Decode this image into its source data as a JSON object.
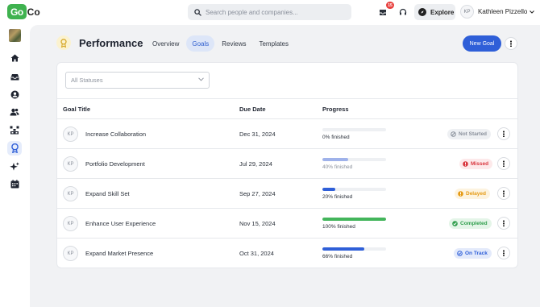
{
  "app": {
    "logo_go": "Go",
    "logo_co": "Co"
  },
  "search": {
    "placeholder": "Search people and companies..."
  },
  "header": {
    "inbox_count": "15",
    "explore_label": "Explore",
    "user_initials": "KP",
    "user_name": "Kathleen Pizzello"
  },
  "page": {
    "title": "Performance",
    "tabs": [
      {
        "label": "Overview",
        "active": false
      },
      {
        "label": "Goals",
        "active": true
      },
      {
        "label": "Reviews",
        "active": false
      },
      {
        "label": "Templates",
        "active": false
      }
    ],
    "new_goal_label": "New Goal"
  },
  "filter": {
    "selected": "All Statuses"
  },
  "table": {
    "headers": {
      "title": "Goal Title",
      "due": "Due Date",
      "progress": "Progress"
    },
    "rows": [
      {
        "initials": "KP",
        "title": "Increase Collaboration",
        "due": "Dec 31, 2024",
        "progress": 0,
        "progress_label": "0% finished",
        "status": "Not Started",
        "progress_color": "#b9c8ee",
        "status_color": "#8a909b",
        "status_bg": "#eef0f3"
      },
      {
        "initials": "KP",
        "title": "Portfolio Development",
        "due": "Jul 29, 2024",
        "progress": 40,
        "progress_label": "40% finished",
        "status": "Missed",
        "progress_color": "#9fb2ea",
        "status_color": "#d9363e",
        "status_bg": "#fde9ea"
      },
      {
        "initials": "KP",
        "title": "Expand Skill Set",
        "due": "Sep 27, 2024",
        "progress": 20,
        "progress_label": "20% finished",
        "status": "Delayed",
        "progress_color": "#2f5fd8",
        "status_color": "#e59a14",
        "status_bg": "#fdf3df"
      },
      {
        "initials": "KP",
        "title": "Enhance User Experience",
        "due": "Nov 15, 2024",
        "progress": 100,
        "progress_label": "100% finished",
        "status": "Completed",
        "progress_color": "#43b55b",
        "status_color": "#2f9e4c",
        "status_bg": "#e4f5e8"
      },
      {
        "initials": "KP",
        "title": "Expand Market Presence",
        "due": "Oct 31, 2024",
        "progress": 66,
        "progress_label": "66% finished",
        "status": "On Track",
        "progress_color": "#2f5fd8",
        "status_color": "#2f5fd8",
        "status_bg": "#e3eafb"
      }
    ]
  },
  "sidebar": {
    "items": [
      {
        "icon": "company-logo-icon"
      },
      {
        "icon": "home-icon"
      },
      {
        "icon": "inbox-icon"
      },
      {
        "icon": "user-circle-icon"
      },
      {
        "icon": "people-icon"
      },
      {
        "icon": "org-chart-icon"
      },
      {
        "icon": "award-icon",
        "active": true
      },
      {
        "icon": "sparkle-icon"
      },
      {
        "icon": "calendar-icon"
      }
    ]
  }
}
